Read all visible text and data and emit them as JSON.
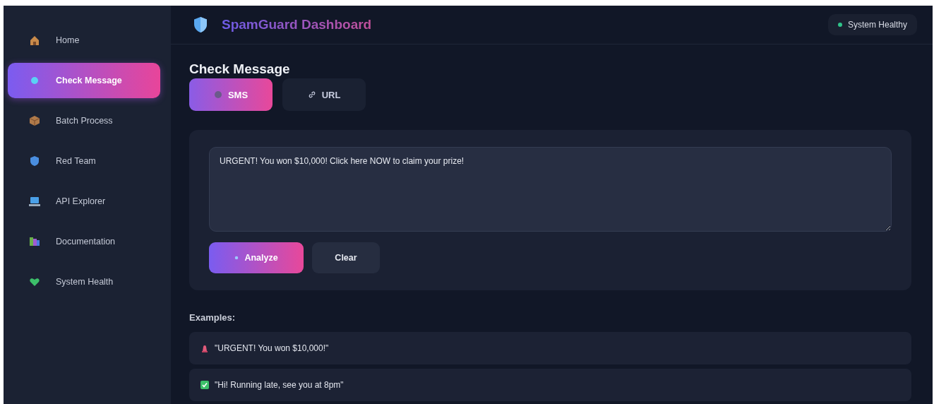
{
  "sidebar": {
    "items": [
      {
        "label": "Home",
        "selected": false
      },
      {
        "label": "Check Message",
        "selected": true
      },
      {
        "label": "Batch Process",
        "selected": false
      },
      {
        "label": "Red Team",
        "selected": false
      },
      {
        "label": "API Explorer",
        "selected": false
      },
      {
        "label": "Documentation",
        "selected": false
      },
      {
        "label": "System Health",
        "selected": false
      }
    ]
  },
  "header": {
    "title": "SpamGuard Dashboard",
    "status": "System Healthy"
  },
  "page_title": "Check Message",
  "tabs": [
    {
      "label": "SMS",
      "selected": true
    },
    {
      "label": "URL",
      "selected": false
    }
  ],
  "message": {
    "value": "URGENT! You won $10,000! Click here NOW to claim your prize!"
  },
  "buttons": [
    {
      "label": "Analyze",
      "kind": "primary"
    },
    {
      "label": "Clear",
      "kind": "secondary"
    }
  ],
  "examples_label": "Examples:",
  "examples": [
    {
      "text": "\"URGENT! You won $10,000!\"",
      "kind": "spam"
    },
    {
      "text": "\"Hi! Running late, see you at 8pm\"",
      "kind": "ham"
    }
  ]
}
